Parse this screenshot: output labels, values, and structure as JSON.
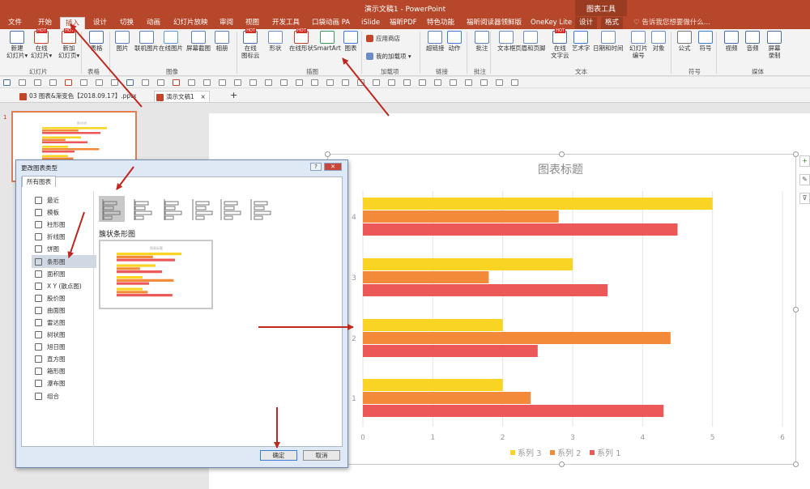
{
  "window": {
    "title": "演示文稿1 - PowerPoint",
    "context_tab_group": "图表工具"
  },
  "tabs": [
    "文件",
    "开始",
    "插入",
    "设计",
    "切换",
    "动画",
    "幻灯片放映",
    "审阅",
    "视图",
    "开发工具",
    "口袋动画 PA",
    "iSlide",
    "福昕PDF",
    "特色功能",
    "福昕阅读器领鲜版",
    "OneKey Lite",
    "设计",
    "格式"
  ],
  "active_tab": "插入",
  "tell_me": "告诉我您想要做什么...",
  "ribbon": {
    "groups": [
      "幻灯片",
      "表格",
      "图像",
      "插图",
      "加载项",
      "链接",
      "批注",
      "文本",
      "符号",
      "媒体"
    ],
    "buttons": [
      {
        "label": "新建\n幻灯片▾",
        "icon": "new-slide-icon"
      },
      {
        "label": "在线\n幻灯片▾",
        "icon": "online-slide-icon",
        "hot": "HOT"
      },
      {
        "label": "新加\n幻灯页▾",
        "icon": "add-page-icon",
        "hot": "HOT"
      },
      {
        "label": "表格",
        "icon": "table-icon"
      },
      {
        "label": "图片",
        "icon": "picture-icon"
      },
      {
        "label": "联机图片",
        "icon": "online-picture-icon"
      },
      {
        "label": "在线图片",
        "icon": "online-image-icon"
      },
      {
        "label": "屏幕截图",
        "icon": "screenshot-icon"
      },
      {
        "label": "相册",
        "icon": "album-icon"
      },
      {
        "label": "在线\n图标云",
        "icon": "icon-cloud-icon",
        "hot": "HOT"
      },
      {
        "label": "形状",
        "icon": "shapes-icon"
      },
      {
        "label": "在线形状",
        "icon": "online-shapes-icon",
        "hot": "HOT"
      },
      {
        "label": "SmartArt",
        "icon": "smartart-icon"
      },
      {
        "label": "图表",
        "icon": "chart-icon"
      },
      {
        "label": "超链接",
        "icon": "hyperlink-icon"
      },
      {
        "label": "动作",
        "icon": "action-icon"
      },
      {
        "label": "批注",
        "icon": "comment-icon"
      },
      {
        "label": "文本框",
        "icon": "textbox-icon"
      },
      {
        "label": "页眉和页脚",
        "icon": "header-footer-icon"
      },
      {
        "label": "在线\n文字云",
        "icon": "word-cloud-icon",
        "hot": "HOT"
      },
      {
        "label": "艺术字",
        "icon": "wordart-icon"
      },
      {
        "label": "日期和时间",
        "icon": "datetime-icon"
      },
      {
        "label": "幻灯片\n编号",
        "icon": "slide-number-icon"
      },
      {
        "label": "对象",
        "icon": "object-icon"
      },
      {
        "label": "公式",
        "icon": "equation-icon"
      },
      {
        "label": "符号",
        "icon": "symbol-icon"
      },
      {
        "label": "视频",
        "icon": "video-icon"
      },
      {
        "label": "音频",
        "icon": "audio-icon"
      },
      {
        "label": "屏幕\n录制",
        "icon": "screen-record-icon"
      }
    ],
    "addin_store": "应用商店",
    "my_addins": "我的加载项"
  },
  "doc_tabs": [
    {
      "label": "03 图表&渐变色【2018.09.17】.pptx"
    },
    {
      "label": "演示文稿1",
      "active": true
    }
  ],
  "slide_number": "1",
  "dialog": {
    "title": "更改图表类型",
    "tab": "所有图表",
    "types": [
      "最近",
      "模板",
      "柱形图",
      "折线图",
      "饼图",
      "条形图",
      "面积图",
      "X Y (散点图)",
      "股价图",
      "曲面图",
      "雷达图",
      "树状图",
      "旭日图",
      "直方图",
      "箱形图",
      "瀑布图",
      "组合"
    ],
    "selected_type": "条形图",
    "subtype_name": "簇状条形图",
    "preview_title": "图表标题",
    "ok": "确定",
    "cancel": "取消"
  },
  "colors": {
    "accent": "#b7472a",
    "series3": "#f9d423",
    "series2": "#f38a3a",
    "series1": "#ec5858",
    "arrow": "#c0271e"
  },
  "chart_data": {
    "type": "bar",
    "orientation": "horizontal",
    "title": "图表标题",
    "categories": [
      "1",
      "2",
      "3",
      "4"
    ],
    "series": [
      {
        "name": "系列 1",
        "values": [
          4.3,
          2.5,
          3.5,
          4.5
        ]
      },
      {
        "name": "系列 2",
        "values": [
          2.4,
          4.4,
          1.8,
          2.8
        ]
      },
      {
        "name": "系列 3",
        "values": [
          2.0,
          2.0,
          3.0,
          5.0
        ]
      }
    ],
    "xlim": [
      0,
      6
    ],
    "x_ticks": [
      "0",
      "1",
      "2",
      "3",
      "4",
      "5",
      "6"
    ],
    "legend": [
      "系列 3",
      "系列 2",
      "系列 1"
    ],
    "legend_position": "bottom",
    "grid": true
  }
}
